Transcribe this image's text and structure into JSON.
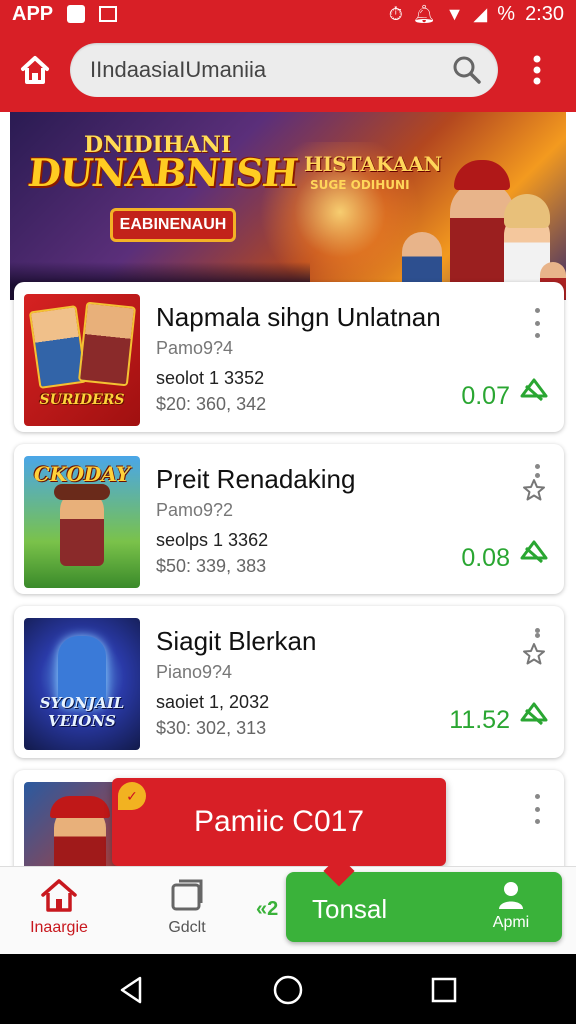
{
  "status_bar": {
    "app_label": "APP",
    "battery": "%",
    "time": "2:30"
  },
  "app_bar": {
    "search_value": "IIndaasiaIUmaniia"
  },
  "banner": {
    "title_top": "DNIDIHANI",
    "title": "DUNABNISH",
    "pill": "EABINENAUH",
    "subtitle": "HISTAKAAN",
    "subtitle_small": "SUGE ODIHUNI"
  },
  "list": [
    {
      "name": "Napmala sihgn Unlatnan",
      "sub": "Pamo9?4",
      "score": "seolot  1  3352",
      "price": "$20: 360, 342",
      "value": "0.07",
      "thumb_label": "SURIDERS",
      "side_icon": "more-icon"
    },
    {
      "name": "Preit Renadaking",
      "sub": "Pamo9?2",
      "score": "seolps  1  3362",
      "price": "$50: 339, 383",
      "value": "0.08",
      "thumb_label": "CKODAY",
      "side_icon": "star-icon"
    },
    {
      "name": "Siagit Blerkan",
      "sub": "Piano9?4",
      "score": "saoiet  1,  2032",
      "price": "$30: 302, 313",
      "value": "11.52",
      "thumb_label": "SYONJAIL VEIONS",
      "side_icon": "star-icon"
    }
  ],
  "toast": {
    "text": "Pamiic C017"
  },
  "bottom_nav": {
    "items": [
      {
        "label": "Inaargie",
        "icon": "home-icon"
      },
      {
        "label": "Gdclt",
        "icon": "library-icon"
      }
    ],
    "cta_lead": "«2",
    "cta_label": "Tonsal",
    "cta_account": "Apmi"
  },
  "colors": {
    "brand_red": "#d81f26",
    "accent_green": "#3ab23a",
    "value_green": "#2aa632"
  }
}
